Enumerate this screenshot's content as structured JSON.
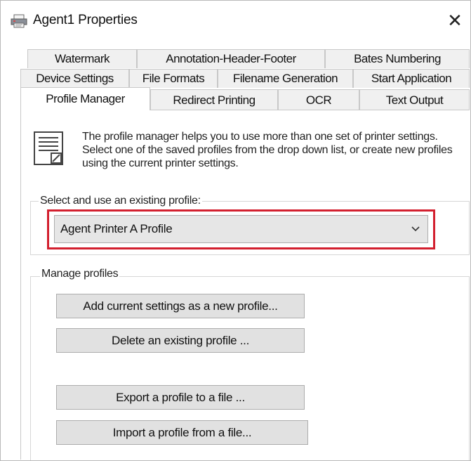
{
  "window": {
    "title": "Agent1 Properties",
    "close_glyph": "✕"
  },
  "tabs": {
    "row1": [
      "Watermark",
      "Annotation-Header-Footer",
      "Bates Numbering"
    ],
    "row2": [
      "Device Settings",
      "File Formats",
      "Filename Generation",
      "Start Application"
    ],
    "row3": [
      "Profile Manager",
      "Redirect Printing",
      "OCR",
      "Text Output"
    ],
    "active": "Profile Manager"
  },
  "intro": {
    "icon": "document-icon",
    "text": "The profile manager helps you to use more than one set of printer settings. Select one of the saved profiles from the drop down list, or create new profiles using the current printer settings."
  },
  "select_group": {
    "legend": "Select and use an existing profile:",
    "selected_profile": "Agent Printer A Profile",
    "highlight_color": "#d3202f"
  },
  "manage_group": {
    "legend": "Manage profiles",
    "add_label": "Add current settings as a new profile...",
    "delete_label": "Delete an existing profile ...",
    "export_label": "Export a profile to a file ...",
    "import_label": "Import a profile from a file..."
  }
}
